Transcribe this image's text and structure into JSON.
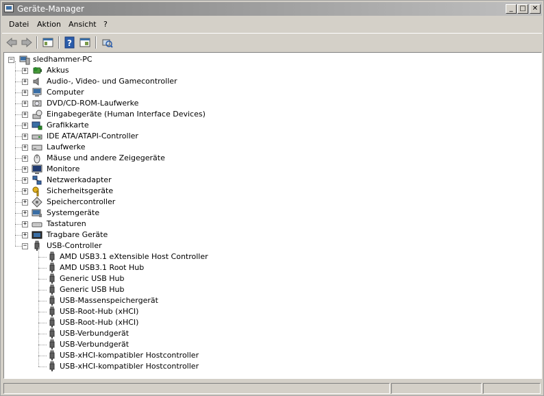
{
  "window": {
    "title": "Geräte-Manager",
    "controls": {
      "minimize": "_",
      "maximize": "□",
      "close": "✕"
    }
  },
  "menu": [
    "Datei",
    "Aktion",
    "Ansicht",
    "?"
  ],
  "toolbar": {
    "buttons": [
      "back-arrow-icon",
      "forward-arrow-icon",
      "show-hide-console-tree-icon",
      "help-icon",
      "properties-icon",
      "scan-hardware-icon"
    ]
  },
  "tree": {
    "root": "sledhammer-PC",
    "categories": [
      {
        "label": "Akkus",
        "icon": "battery-icon",
        "expander": "+"
      },
      {
        "label": "Audio-, Video- und Gamecontroller",
        "icon": "speaker-icon",
        "expander": "+"
      },
      {
        "label": "Computer",
        "icon": "computer-icon",
        "expander": "+"
      },
      {
        "label": "DVD/CD-ROM-Laufwerke",
        "icon": "cdrom-icon",
        "expander": "+"
      },
      {
        "label": "Eingabegeräte (Human Interface Devices)",
        "icon": "hid-icon",
        "expander": "+"
      },
      {
        "label": "Grafikkarte",
        "icon": "display-adapter-icon",
        "expander": "+"
      },
      {
        "label": "IDE ATA/ATAPI-Controller",
        "icon": "ide-controller-icon",
        "expander": "+"
      },
      {
        "label": "Laufwerke",
        "icon": "disk-drive-icon",
        "expander": "+"
      },
      {
        "label": "Mäuse und andere Zeigegeräte",
        "icon": "mouse-icon",
        "expander": "+"
      },
      {
        "label": "Monitore",
        "icon": "monitor-icon",
        "expander": "+"
      },
      {
        "label": "Netzwerkadapter",
        "icon": "network-adapter-icon",
        "expander": "+"
      },
      {
        "label": "Sicherheitsgeräte",
        "icon": "security-key-icon",
        "expander": "+"
      },
      {
        "label": "Speichercontroller",
        "icon": "storage-controller-icon",
        "expander": "+"
      },
      {
        "label": "Systemgeräte",
        "icon": "system-devices-icon",
        "expander": "+"
      },
      {
        "label": "Tastaturen",
        "icon": "keyboard-icon",
        "expander": "+"
      },
      {
        "label": "Tragbare Geräte",
        "icon": "portable-device-icon",
        "expander": "+"
      },
      {
        "label": "USB-Controller",
        "icon": "usb-plug-icon",
        "expander": "−"
      }
    ],
    "usb_children": [
      "AMD USB3.1 eXtensible Host Controller",
      "AMD USB3.1 Root Hub",
      "Generic USB Hub",
      "Generic USB Hub",
      "USB-Massenspeichergerät",
      "USB-Root-Hub (xHCI)",
      "USB-Root-Hub (xHCI)",
      "USB-Verbundgerät",
      "USB-Verbundgerät",
      "USB-xHCI-kompatibler Hostcontroller",
      "USB-xHCI-kompatibler Hostcontroller"
    ]
  },
  "status": [
    "",
    "",
    ""
  ]
}
